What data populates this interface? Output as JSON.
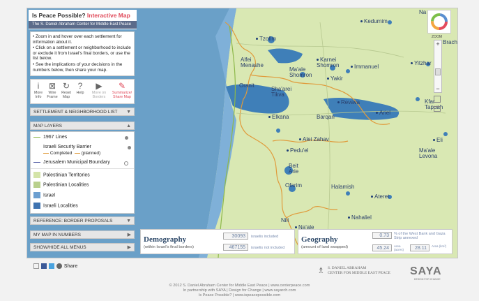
{
  "app": {
    "title_main": "Is Peace Possible?",
    "title_accent": "Interactive Map",
    "subtitle": "The S. Daniel Abraham Center for Middle East Peace"
  },
  "instructions": [
    "• Zoom in and hover over each settlement for information about it.",
    "• Click on a settlement or neighborhood to include or exclude it from Israel's final borders, or use the list below.",
    "• See the implications of your decisions in the numbers below, then share your map."
  ],
  "tools": [
    {
      "label": "More Info",
      "icon": "info-icon"
    },
    {
      "label": "Wire Frame",
      "icon": "wireframe-icon"
    },
    {
      "label": "Reset Map",
      "icon": "reset-icon"
    },
    {
      "label": "Help",
      "icon": "help-icon"
    },
    {
      "label": "Move on Borders",
      "icon": "play-icon"
    },
    {
      "label": "Summarize/ Share Map",
      "icon": "share-icon"
    }
  ],
  "menus": {
    "settlement_list": "SETTLEMENT & NEIGHBORHOOD LIST",
    "map_layers": "MAP LAYERS",
    "reference": "REFERENCE: BORDER PROPOSALS",
    "my_map": "MY MAP IN NUMBERS",
    "show_hide": "SHOW/HIDE ALL MENUS"
  },
  "layers": {
    "lines_1967": "1967 Lines",
    "barrier": "Israeli Security Barrier",
    "barrier_completed": "Completed",
    "barrier_planned": "(planned)",
    "jerusalem": "Jerusalem Municipal Boundary",
    "pal_territories": "Palestinian Territories",
    "pal_localities": "Palestinian Localities",
    "israel": "Israel",
    "isr_localities": "Israeli Localities"
  },
  "colors": {
    "accent": "#e04a5a",
    "sea": "#6aa0c8",
    "pal_territories": "#d4e4a8",
    "pal_localities": "#b9d08c",
    "israel": "#6c9fd0",
    "isr_localities": "#3f73b0"
  },
  "map_labels": [
    "Na",
    "Kedumim",
    "Tzofim",
    "Alfei Menashe",
    "Karnei Shomron",
    "Ma'ale Shomron",
    "Immanuel",
    "Yakir",
    "Yitzhar",
    "Oranit",
    "Sha'arei Tikva",
    "Elkana",
    "Revava",
    "Barqan",
    "Ariel",
    "Kfar Tapuah",
    "Alei Zahav",
    "Eli",
    "Pedu'el",
    "Ma'ale Levona",
    "Beit Arie",
    "Ofarim",
    "Halamish",
    "Ateret",
    "Nahaliel",
    "Nili",
    "Na'ale",
    "Brachá"
  ],
  "zoom": {
    "label": "ZOOM"
  },
  "demography": {
    "heading": "Demography",
    "sub": "(within Israel's final borders)",
    "included_value": "30093",
    "included_label": "israelis included",
    "excluded_value": "467155",
    "excluded_label": "israelis not included"
  },
  "geography": {
    "heading": "Geography",
    "sub": "(amount of land swapped)",
    "percent_value": "0.73",
    "percent_label": "% of the West Bank and Gaza Strip annexed",
    "area_value_1": "45.24",
    "area_value_2": "28.11",
    "area_label_1": "Area (acres)",
    "area_label_2": "Area (km²)"
  },
  "share": {
    "label": "Share"
  },
  "org": {
    "line1": "S. DANIEL ABRAHAM",
    "line2": "CENTER FOR MIDDLE EAST PEACE",
    "saya": "SAYA",
    "saya_sub": "DESIGN FOR CHANGE"
  },
  "footer": {
    "line1": "© 2012 S. Daniel Abraham Center for Middle East Peace | www.centerpeace.com",
    "line2": "In partnership with SAYA | Design for Change | www.sayarch.com",
    "line3": "Is Peace Possible? | www.ispeacepossible.com"
  }
}
